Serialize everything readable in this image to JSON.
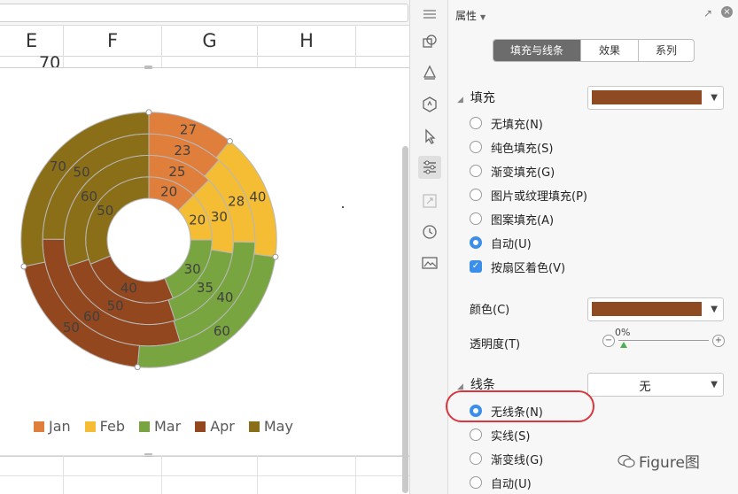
{
  "sheet": {
    "columns": [
      "E",
      "F",
      "G",
      "H"
    ],
    "cell_value": "70"
  },
  "chart_data": {
    "type": "pie",
    "subtype": "multi-level doughnut",
    "categories": [
      "Jan",
      "Feb",
      "Mar",
      "Apr",
      "May"
    ],
    "colors": [
      "#E07E3C",
      "#F5BD33",
      "#79A540",
      "#92471E",
      "#8B6E18"
    ],
    "series": [
      {
        "values": [
          20,
          20,
          30,
          40,
          50
        ]
      },
      {
        "values": [
          25,
          30,
          35,
          50,
          60
        ]
      },
      {
        "values": [
          23,
          28,
          40,
          60,
          50
        ]
      },
      {
        "values": [
          27,
          40,
          60,
          50,
          70
        ]
      }
    ],
    "legend_position": "bottom",
    "title": ""
  },
  "panel": {
    "title": "属性",
    "tabs": [
      {
        "label": "填充与线条",
        "active": true
      },
      {
        "label": "效果",
        "active": false
      },
      {
        "label": "系列",
        "active": false
      }
    ],
    "fill": {
      "heading": "填充",
      "color": "#8E4A20",
      "options": [
        {
          "label": "无填充(N)",
          "checked": false
        },
        {
          "label": "纯色填充(S)",
          "checked": false
        },
        {
          "label": "渐变填充(G)",
          "checked": false
        },
        {
          "label": "图片或纹理填充(P)",
          "checked": false
        },
        {
          "label": "图案填充(A)",
          "checked": false
        },
        {
          "label": "自动(U)",
          "checked": true
        }
      ],
      "vary_label": "按扇区着色(V)",
      "color_label": "颜色(C)",
      "color_value": "#8E4A20",
      "transparency_label": "透明度(T)",
      "transparency_value": "0%"
    },
    "line": {
      "heading": "线条",
      "dropdown_value": "无",
      "options": [
        {
          "label": "无线条(N)",
          "checked": true
        },
        {
          "label": "实线(S)",
          "checked": false
        },
        {
          "label": "渐变线(G)",
          "checked": false
        },
        {
          "label": "自动(U)",
          "checked": false
        }
      ]
    }
  },
  "watermark": "Figure图"
}
